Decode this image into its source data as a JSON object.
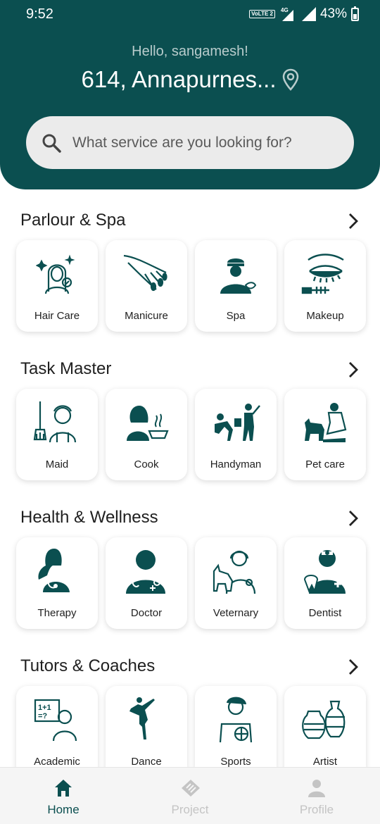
{
  "status_bar": {
    "time": "9:52",
    "volte": "VoLTE 2",
    "network": "4G",
    "battery": "43%"
  },
  "header": {
    "greeting": "Hello, sangamesh!",
    "address": "614, Annapurnes...",
    "search_placeholder": "What service are you looking for?"
  },
  "sections": [
    {
      "title": "Parlour & Spa",
      "items": [
        {
          "label": "Hair Care"
        },
        {
          "label": "Manicure"
        },
        {
          "label": "Spa"
        },
        {
          "label": "Makeup"
        }
      ]
    },
    {
      "title": "Task Master",
      "items": [
        {
          "label": "Maid"
        },
        {
          "label": "Cook"
        },
        {
          "label": "Handyman"
        },
        {
          "label": "Pet care"
        }
      ]
    },
    {
      "title": "Health & Wellness",
      "items": [
        {
          "label": "Therapy"
        },
        {
          "label": "Doctor"
        },
        {
          "label": "Veternary"
        },
        {
          "label": "Dentist"
        }
      ]
    },
    {
      "title": "Tutors & Coaches",
      "items": [
        {
          "label": "Academic"
        },
        {
          "label": "Dance"
        },
        {
          "label": "Sports"
        },
        {
          "label": "Artist"
        }
      ]
    }
  ],
  "bottom_nav": [
    {
      "label": "Home",
      "active": true
    },
    {
      "label": "Project",
      "active": false
    },
    {
      "label": "Profile",
      "active": false
    }
  ],
  "colors": {
    "primary": "#0b4f50",
    "search_bg": "#ebebeb",
    "inactive_nav": "#c4c4c4"
  }
}
